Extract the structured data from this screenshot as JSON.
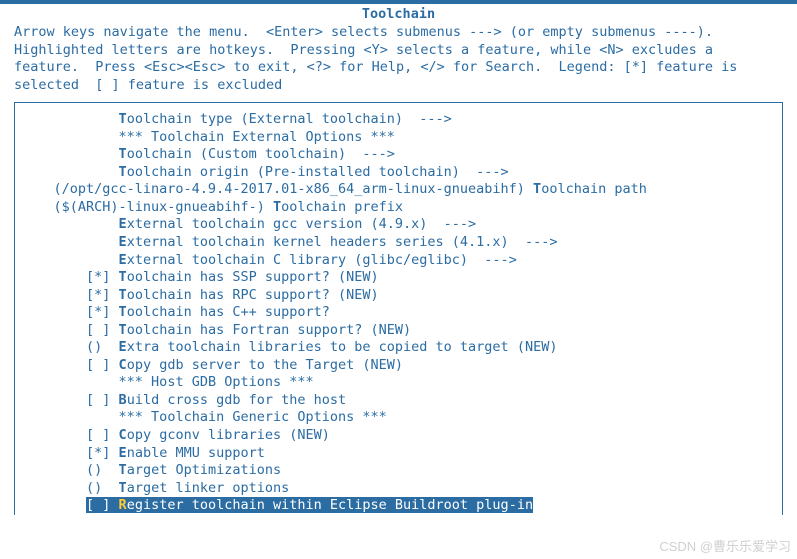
{
  "title": "Toolchain",
  "help": "Arrow keys navigate the menu.  <Enter> selects submenus ---> (or empty submenus ----).  Highlighted letters are hotkeys.  Pressing <Y> selects a feature, while <N> excludes a feature.  Press <Esc><Esc> to exit, <?> for Help, </> for Search.  Legend: [*] feature is selected  [ ] feature is excluded",
  "watermark": "CSDN @曹乐乐爱学习",
  "items": [
    {
      "indent": 12,
      "prefix": "",
      "hk": "T",
      "rest": "oolchain type (External toolchain)  --->",
      "interactable": true
    },
    {
      "indent": 12,
      "prefix": "",
      "hk": "",
      "rest": "*** Toolchain External Options ***",
      "interactable": false
    },
    {
      "indent": 12,
      "prefix": "",
      "hk": "T",
      "rest": "oolchain (Custom toolchain)  --->",
      "interactable": true
    },
    {
      "indent": 12,
      "prefix": "",
      "hk": "T",
      "rest": "oolchain origin (Pre-installed toolchain)  --->",
      "interactable": true
    },
    {
      "indent": 4,
      "prefix": "(/opt/gcc-linaro-4.9.4-2017.01-x86_64_arm-linux-gnueabihf) ",
      "hk": "T",
      "rest": "oolchain path",
      "interactable": true
    },
    {
      "indent": 4,
      "prefix": "($(ARCH)-linux-gnueabihf-) ",
      "hk": "T",
      "rest": "oolchain prefix",
      "interactable": true
    },
    {
      "indent": 12,
      "prefix": "",
      "hk": "E",
      "rest": "xternal toolchain gcc version (4.9.x)  --->",
      "interactable": true
    },
    {
      "indent": 12,
      "prefix": "",
      "hk": "E",
      "rest": "xternal toolchain kernel headers series (4.1.x)  --->",
      "interactable": true
    },
    {
      "indent": 12,
      "prefix": "",
      "hk": "E",
      "rest": "xternal toolchain C library (glibc/eglibc)  --->",
      "interactable": true
    },
    {
      "indent": 8,
      "prefix": "[*] ",
      "hk": "T",
      "rest": "oolchain has SSP support? (NEW)",
      "interactable": true
    },
    {
      "indent": 8,
      "prefix": "[*] ",
      "hk": "T",
      "rest": "oolchain has RPC support? (NEW)",
      "interactable": true
    },
    {
      "indent": 8,
      "prefix": "[*] ",
      "hk": "T",
      "rest": "oolchain has C++ support?",
      "interactable": true
    },
    {
      "indent": 8,
      "prefix": "[ ] ",
      "hk": "T",
      "rest": "oolchain has Fortran support? (NEW)",
      "interactable": true
    },
    {
      "indent": 8,
      "prefix": "()  ",
      "hk": "E",
      "rest": "xtra toolchain libraries to be copied to target (NEW)",
      "interactable": true
    },
    {
      "indent": 8,
      "prefix": "[ ] ",
      "hk": "C",
      "rest": "opy gdb server to the Target (NEW)",
      "interactable": true
    },
    {
      "indent": 12,
      "prefix": "",
      "hk": "",
      "rest": "*** Host GDB Options ***",
      "interactable": false
    },
    {
      "indent": 8,
      "prefix": "[ ] ",
      "hk": "B",
      "rest": "uild cross gdb for the host",
      "interactable": true
    },
    {
      "indent": 12,
      "prefix": "",
      "hk": "",
      "rest": "*** Toolchain Generic Options ***",
      "interactable": false
    },
    {
      "indent": 8,
      "prefix": "[ ] ",
      "hk": "C",
      "rest": "opy gconv libraries (NEW)",
      "interactable": true
    },
    {
      "indent": 8,
      "prefix": "[*] ",
      "hk": "E",
      "rest": "nable MMU support",
      "interactable": true
    },
    {
      "indent": 8,
      "prefix": "()  ",
      "hk": "T",
      "rest": "arget Optimizations",
      "interactable": true
    },
    {
      "indent": 8,
      "prefix": "()  ",
      "hk": "T",
      "rest": "arget linker options",
      "interactable": true
    },
    {
      "indent": 8,
      "prefix": "[ ] ",
      "hk": "R",
      "rest": "egister toolchain within Eclipse Buildroot plug-in",
      "interactable": true,
      "selected": true
    }
  ]
}
